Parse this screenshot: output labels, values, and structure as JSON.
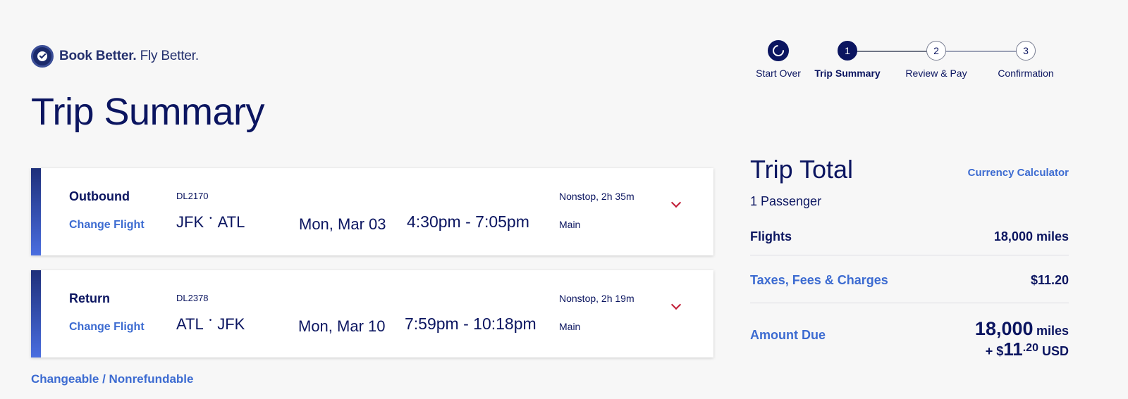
{
  "brand": {
    "tagline_bold": "Book Better.",
    "tagline_rest": " Fly Better."
  },
  "stepper": {
    "start_over": "Start Over",
    "steps": [
      {
        "number": "1",
        "label": "Trip Summary"
      },
      {
        "number": "2",
        "label": "Review & Pay"
      },
      {
        "number": "3",
        "label": "Confirmation"
      }
    ]
  },
  "page_title": "Trip Summary",
  "flights": [
    {
      "direction": "Outbound",
      "change_label": "Change Flight",
      "flight_number": "DL2170",
      "origin": "JFK",
      "destination": "ATL",
      "date": "Mon, Mar 03",
      "times": "4:30pm - 7:05pm",
      "stops": "Nonstop, 2h 35m",
      "cabin": "Main"
    },
    {
      "direction": "Return",
      "change_label": "Change Flight",
      "flight_number": "DL2378",
      "origin": "ATL",
      "destination": "JFK",
      "date": "Mon, Mar 10",
      "times": "7:59pm - 10:18pm",
      "stops": "Nonstop, 2h 19m",
      "cabin": "Main"
    }
  ],
  "policy": "Changeable / Nonrefundable",
  "trip_total": {
    "title": "Trip Total",
    "currency_calculator": "Currency Calculator",
    "passengers": "1 Passenger",
    "flights_label": "Flights",
    "flights_value": "18,000 miles",
    "taxes_label": "Taxes, Fees & Charges",
    "taxes_value": "$11.20",
    "amount_due_label": "Amount Due",
    "amount_miles": "18,000",
    "amount_miles_unit": "miles",
    "amount_plus": "+ $",
    "amount_dollars": "11",
    "amount_cents": ".20",
    "amount_currency": "USD"
  },
  "colors": {
    "navy": "#0b1560",
    "link_blue": "#3c6bd1",
    "chevron_red": "#c01933"
  }
}
